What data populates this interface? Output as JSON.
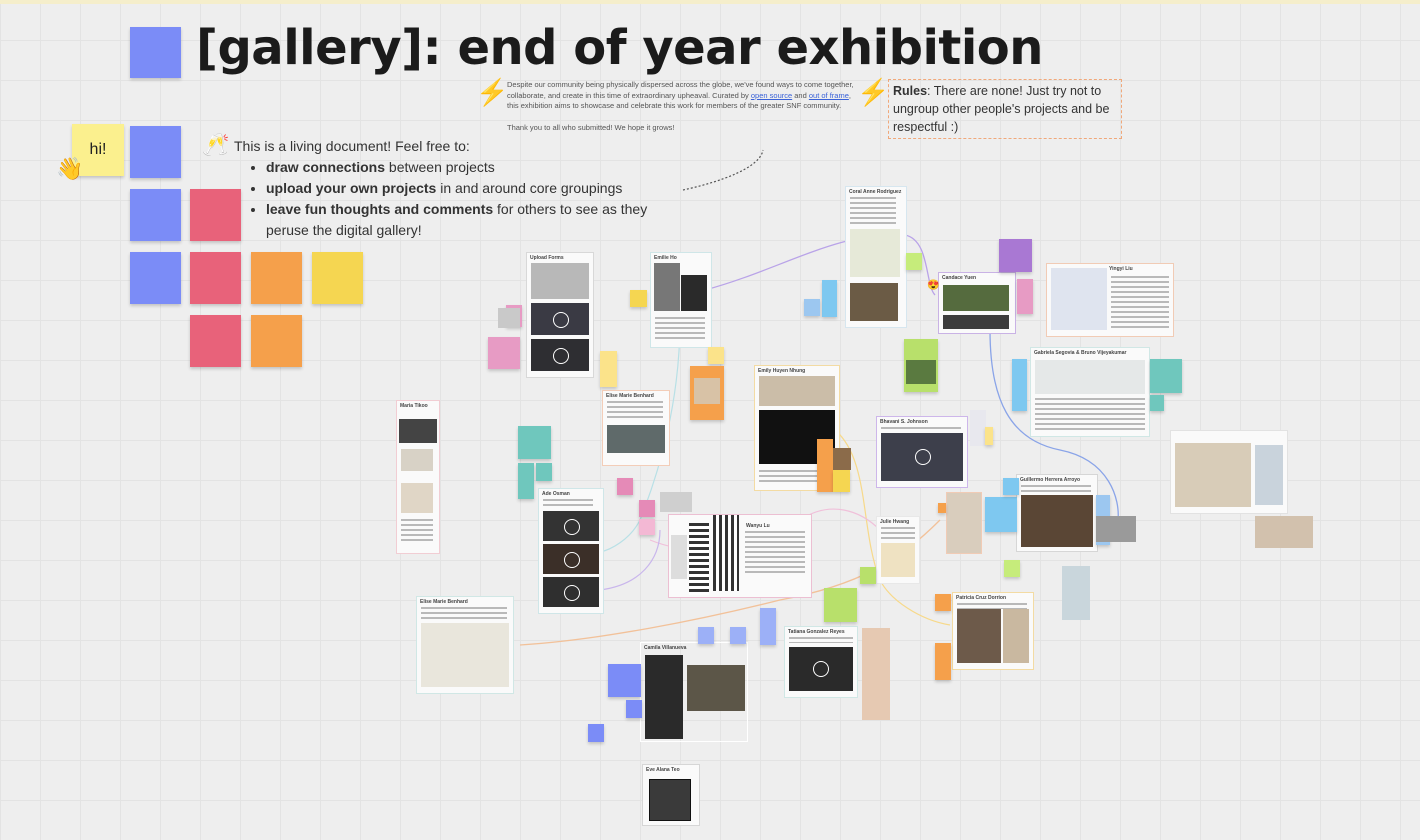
{
  "board": {
    "title": "[gallery]: end of year exhibition",
    "hi_note": "hi!",
    "intro": {
      "lead": "This is a living document! Feel free to:",
      "items": [
        {
          "bold": "draw connections",
          "rest": " between projects"
        },
        {
          "bold": "upload your own projects",
          "rest": " in and around core groupings"
        },
        {
          "bold": "leave fun thoughts and comments",
          "rest": " for others to see as they peruse the digital gallery!"
        }
      ]
    },
    "description": {
      "p1_a": "Despite our community being physically dispersed across the globe, we've found ways to come together, collaborate, and create in this time of extraordinary upheaval. Curated by ",
      "link1": "open source",
      "p1_b": " and ",
      "link2": "out of frame",
      "p1_c": ", this exhibition aims to showcase and celebrate this work for members of the greater SNF community.",
      "p2": "Thank you to all who submitted! We hope it grows!"
    },
    "rules": {
      "label": "Rules",
      "text": ": There are none! Just try not to ungroup other people's projects and be respectful :)"
    },
    "colors": {
      "blue": "#7b8cf7",
      "red": "#e8627a",
      "orange": "#f5a04b",
      "yellow": "#f5d651",
      "teal": "#6fc7bd",
      "green": "#b8e06b",
      "purple": "#a978d3",
      "pink": "#e79bc4",
      "lightblue": "#7ec8f0"
    },
    "icons": [
      "waving-hand-icon",
      "champagne-icon",
      "lightning-icon",
      "lightning-icon",
      "play-icon"
    ]
  },
  "cards": [
    {
      "id": "upload-forms",
      "title": "Upload Forms"
    },
    {
      "id": "emilie",
      "title": "Emilie Ho"
    },
    {
      "id": "coral",
      "title": "Coral Anne Rodriguez"
    },
    {
      "id": "candace",
      "title": "Candace Yuen"
    },
    {
      "id": "yingyi",
      "title": "Yingyi Liu"
    },
    {
      "id": "gabriela",
      "title": "Gabriela Segovia & Bruno Vijeyakumar"
    },
    {
      "id": "emily",
      "title": "Emily Huyen Nhung"
    },
    {
      "id": "elise",
      "title": "Elise Marie Benhard"
    },
    {
      "id": "maria",
      "title": "Maria Tikoo"
    },
    {
      "id": "ade",
      "title": "Ade Osman"
    },
    {
      "id": "wanyu",
      "title": "Wanyu Lu"
    },
    {
      "id": "bhavani",
      "title": "Bhavani S. Johnson"
    },
    {
      "id": "guillermo",
      "title": "Guillermo Herrera Arroyo"
    },
    {
      "id": "julie",
      "title": "Julie Hwang"
    },
    {
      "id": "elise2",
      "title": "Elise Marie Benhard"
    },
    {
      "id": "camila",
      "title": "Camila Villanueva"
    },
    {
      "id": "tatiana",
      "title": "Tatiana Gonzalez Reyes"
    },
    {
      "id": "patricia",
      "title": "Patricia Cruz Dorrion"
    },
    {
      "id": "eve",
      "title": "Eve Alana Teo"
    }
  ]
}
